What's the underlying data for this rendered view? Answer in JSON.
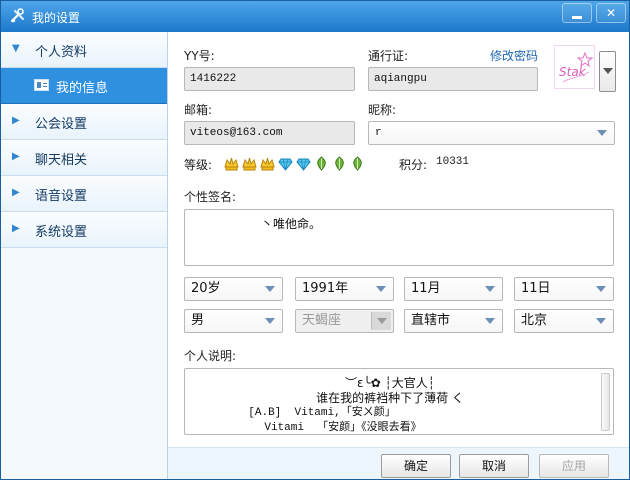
{
  "window": {
    "title": "我的设置"
  },
  "sidebar": {
    "items": [
      {
        "label": "个人资料",
        "expanded": true
      },
      {
        "label": "我的信息",
        "selected": true
      },
      {
        "label": "公会设置"
      },
      {
        "label": "聊天相关"
      },
      {
        "label": "语音设置"
      },
      {
        "label": "系统设置"
      }
    ]
  },
  "profile": {
    "yy_label": "YY号:",
    "yy_value": "1416222",
    "passport_label": "通行证:",
    "passport_value": "aqiangpu",
    "change_password": "修改密码",
    "email_label": "邮箱:",
    "email_value": "viteos@163.com",
    "nickname_label": "昵称:",
    "nickname_value": "r",
    "level_label": "等级:",
    "score_label": "积分:",
    "score_value": "10331",
    "signature_label": "个性签名:",
    "signature_value": "丶唯他命。",
    "age": "20岁",
    "year": "1991年",
    "month": "11月",
    "day": "11日",
    "gender": "男",
    "zodiac": "天蝎座",
    "province": "直辖市",
    "city": "北京",
    "description_label": "个人说明:",
    "description_lines": [
      "︶ε╰✿ ┆大官人┆",
      "谁在我的裤裆种下了薄荷 く",
      "[A.B]  Vitami,「安ㄨ颜」",
      "Vitami  「安颜」《没眼去看》"
    ]
  },
  "buttons": {
    "ok": "确定",
    "cancel": "取消",
    "apply": "应用"
  },
  "colors": {
    "title_blue": "#1c78cb",
    "selected_nav": "#2f90df",
    "panel_bg": "#ffffff",
    "link_blue": "#1d67b6"
  },
  "icons": {
    "window": "tools-icon",
    "nav_arrow": "triangle-right-icon",
    "selected_item": "id-card-icon",
    "minimize": "minimize-icon",
    "close": "close-icon",
    "level_badges": [
      "crown-icon",
      "crown-icon",
      "crown-icon",
      "diamond-icon",
      "diamond-icon",
      "leaf-icon",
      "leaf-icon",
      "leaf-icon"
    ]
  }
}
